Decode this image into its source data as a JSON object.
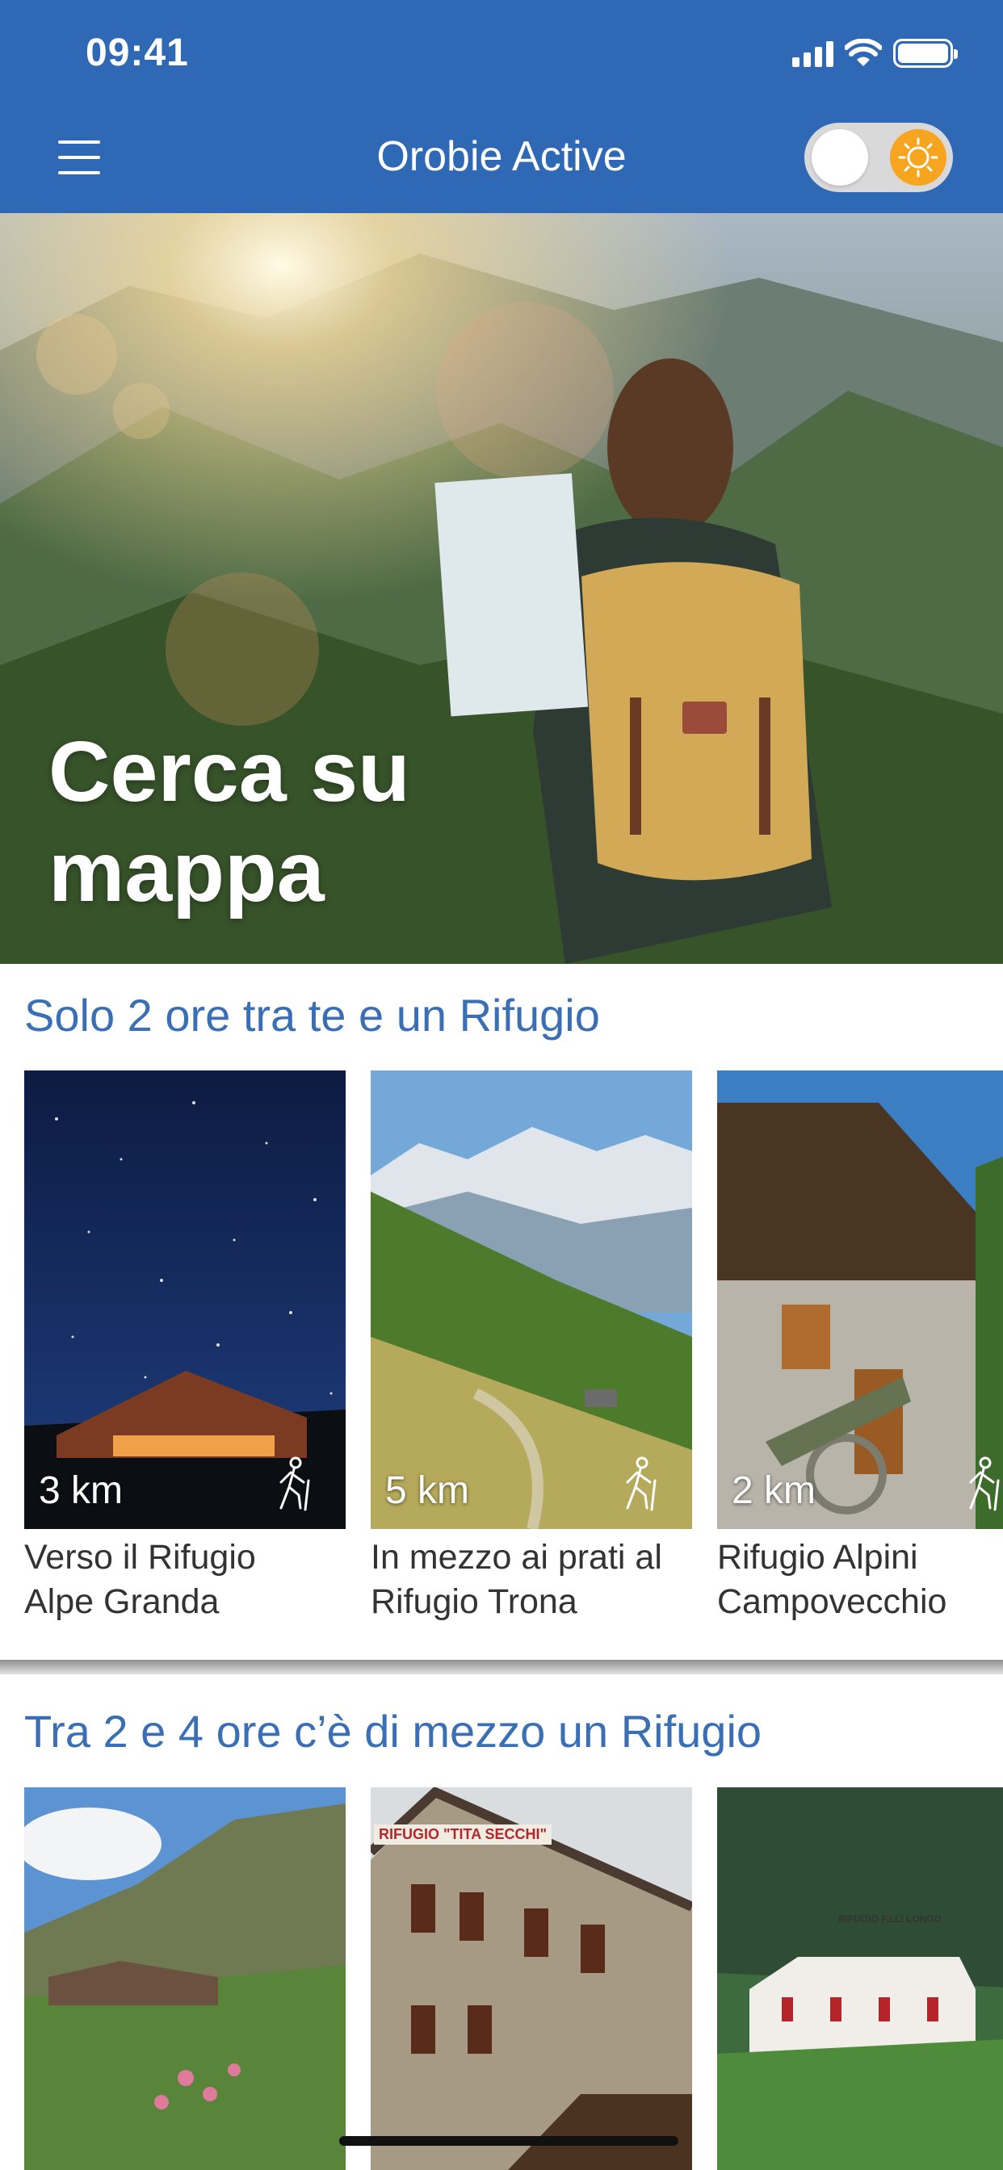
{
  "status_bar": {
    "time": "09:41"
  },
  "header": {
    "title": "Orobie Active",
    "menu_icon": "hamburger-icon",
    "toggle_icon": "sun-icon"
  },
  "hero": {
    "title_line1": "Cerca su",
    "title_line2": "mappa"
  },
  "sections": [
    {
      "title": "Solo 2 ore tra te e un Rifugio",
      "cards": [
        {
          "distance": "3 km",
          "name_line1": "Verso il Rifugio",
          "name_line2": "Alpe Granda"
        },
        {
          "distance": "5 km",
          "name_line1": "In mezzo ai prati al",
          "name_line2": "Rifugio Trona"
        },
        {
          "distance": "2 km",
          "name_line1": "Rifugio Alpini",
          "name_line2": "Campovecchio"
        }
      ]
    },
    {
      "title": "Tra 2 e 4 ore c’è di mezzo un Rifugio",
      "cards": [
        {
          "sign_text": "RIFUGIO \"TITA SECCHI\""
        },
        {
          "sign_text": "RIFUGIO F.LLI LONGO"
        }
      ]
    }
  ],
  "colors": {
    "primary": "#2f69b6",
    "section_title": "#3a6fb5",
    "accent_sun": "#f7a51f"
  }
}
